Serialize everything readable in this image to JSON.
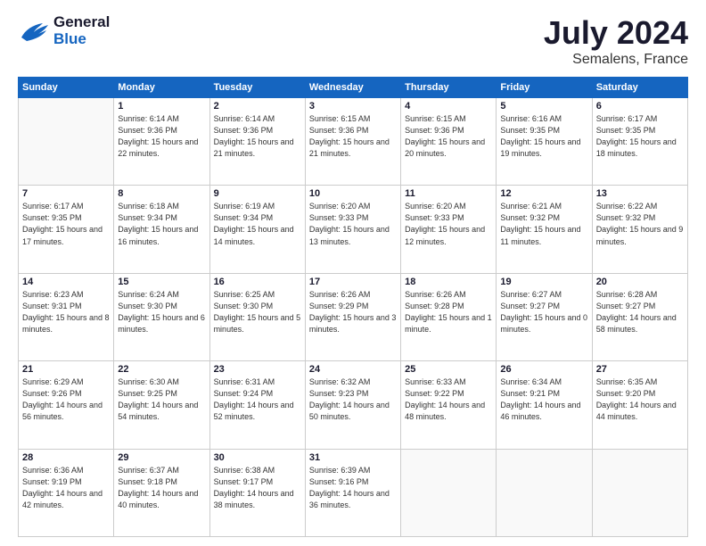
{
  "header": {
    "logo_general": "General",
    "logo_blue": "Blue",
    "month_year": "July 2024",
    "location": "Semalens, France"
  },
  "days_of_week": [
    "Sunday",
    "Monday",
    "Tuesday",
    "Wednesday",
    "Thursday",
    "Friday",
    "Saturday"
  ],
  "weeks": [
    [
      {
        "day": "",
        "empty": true
      },
      {
        "day": "1",
        "sunrise": "Sunrise: 6:14 AM",
        "sunset": "Sunset: 9:36 PM",
        "daylight": "Daylight: 15 hours and 22 minutes."
      },
      {
        "day": "2",
        "sunrise": "Sunrise: 6:14 AM",
        "sunset": "Sunset: 9:36 PM",
        "daylight": "Daylight: 15 hours and 21 minutes."
      },
      {
        "day": "3",
        "sunrise": "Sunrise: 6:15 AM",
        "sunset": "Sunset: 9:36 PM",
        "daylight": "Daylight: 15 hours and 21 minutes."
      },
      {
        "day": "4",
        "sunrise": "Sunrise: 6:15 AM",
        "sunset": "Sunset: 9:36 PM",
        "daylight": "Daylight: 15 hours and 20 minutes."
      },
      {
        "day": "5",
        "sunrise": "Sunrise: 6:16 AM",
        "sunset": "Sunset: 9:35 PM",
        "daylight": "Daylight: 15 hours and 19 minutes."
      },
      {
        "day": "6",
        "sunrise": "Sunrise: 6:17 AM",
        "sunset": "Sunset: 9:35 PM",
        "daylight": "Daylight: 15 hours and 18 minutes."
      }
    ],
    [
      {
        "day": "7",
        "sunrise": "Sunrise: 6:17 AM",
        "sunset": "Sunset: 9:35 PM",
        "daylight": "Daylight: 15 hours and 17 minutes."
      },
      {
        "day": "8",
        "sunrise": "Sunrise: 6:18 AM",
        "sunset": "Sunset: 9:34 PM",
        "daylight": "Daylight: 15 hours and 16 minutes."
      },
      {
        "day": "9",
        "sunrise": "Sunrise: 6:19 AM",
        "sunset": "Sunset: 9:34 PM",
        "daylight": "Daylight: 15 hours and 14 minutes."
      },
      {
        "day": "10",
        "sunrise": "Sunrise: 6:20 AM",
        "sunset": "Sunset: 9:33 PM",
        "daylight": "Daylight: 15 hours and 13 minutes."
      },
      {
        "day": "11",
        "sunrise": "Sunrise: 6:20 AM",
        "sunset": "Sunset: 9:33 PM",
        "daylight": "Daylight: 15 hours and 12 minutes."
      },
      {
        "day": "12",
        "sunrise": "Sunrise: 6:21 AM",
        "sunset": "Sunset: 9:32 PM",
        "daylight": "Daylight: 15 hours and 11 minutes."
      },
      {
        "day": "13",
        "sunrise": "Sunrise: 6:22 AM",
        "sunset": "Sunset: 9:32 PM",
        "daylight": "Daylight: 15 hours and 9 minutes."
      }
    ],
    [
      {
        "day": "14",
        "sunrise": "Sunrise: 6:23 AM",
        "sunset": "Sunset: 9:31 PM",
        "daylight": "Daylight: 15 hours and 8 minutes."
      },
      {
        "day": "15",
        "sunrise": "Sunrise: 6:24 AM",
        "sunset": "Sunset: 9:30 PM",
        "daylight": "Daylight: 15 hours and 6 minutes."
      },
      {
        "day": "16",
        "sunrise": "Sunrise: 6:25 AM",
        "sunset": "Sunset: 9:30 PM",
        "daylight": "Daylight: 15 hours and 5 minutes."
      },
      {
        "day": "17",
        "sunrise": "Sunrise: 6:26 AM",
        "sunset": "Sunset: 9:29 PM",
        "daylight": "Daylight: 15 hours and 3 minutes."
      },
      {
        "day": "18",
        "sunrise": "Sunrise: 6:26 AM",
        "sunset": "Sunset: 9:28 PM",
        "daylight": "Daylight: 15 hours and 1 minute."
      },
      {
        "day": "19",
        "sunrise": "Sunrise: 6:27 AM",
        "sunset": "Sunset: 9:27 PM",
        "daylight": "Daylight: 15 hours and 0 minutes."
      },
      {
        "day": "20",
        "sunrise": "Sunrise: 6:28 AM",
        "sunset": "Sunset: 9:27 PM",
        "daylight": "Daylight: 14 hours and 58 minutes."
      }
    ],
    [
      {
        "day": "21",
        "sunrise": "Sunrise: 6:29 AM",
        "sunset": "Sunset: 9:26 PM",
        "daylight": "Daylight: 14 hours and 56 minutes."
      },
      {
        "day": "22",
        "sunrise": "Sunrise: 6:30 AM",
        "sunset": "Sunset: 9:25 PM",
        "daylight": "Daylight: 14 hours and 54 minutes."
      },
      {
        "day": "23",
        "sunrise": "Sunrise: 6:31 AM",
        "sunset": "Sunset: 9:24 PM",
        "daylight": "Daylight: 14 hours and 52 minutes."
      },
      {
        "day": "24",
        "sunrise": "Sunrise: 6:32 AM",
        "sunset": "Sunset: 9:23 PM",
        "daylight": "Daylight: 14 hours and 50 minutes."
      },
      {
        "day": "25",
        "sunrise": "Sunrise: 6:33 AM",
        "sunset": "Sunset: 9:22 PM",
        "daylight": "Daylight: 14 hours and 48 minutes."
      },
      {
        "day": "26",
        "sunrise": "Sunrise: 6:34 AM",
        "sunset": "Sunset: 9:21 PM",
        "daylight": "Daylight: 14 hours and 46 minutes."
      },
      {
        "day": "27",
        "sunrise": "Sunrise: 6:35 AM",
        "sunset": "Sunset: 9:20 PM",
        "daylight": "Daylight: 14 hours and 44 minutes."
      }
    ],
    [
      {
        "day": "28",
        "sunrise": "Sunrise: 6:36 AM",
        "sunset": "Sunset: 9:19 PM",
        "daylight": "Daylight: 14 hours and 42 minutes."
      },
      {
        "day": "29",
        "sunrise": "Sunrise: 6:37 AM",
        "sunset": "Sunset: 9:18 PM",
        "daylight": "Daylight: 14 hours and 40 minutes."
      },
      {
        "day": "30",
        "sunrise": "Sunrise: 6:38 AM",
        "sunset": "Sunset: 9:17 PM",
        "daylight": "Daylight: 14 hours and 38 minutes."
      },
      {
        "day": "31",
        "sunrise": "Sunrise: 6:39 AM",
        "sunset": "Sunset: 9:16 PM",
        "daylight": "Daylight: 14 hours and 36 minutes."
      },
      {
        "day": "",
        "empty": true
      },
      {
        "day": "",
        "empty": true
      },
      {
        "day": "",
        "empty": true
      }
    ]
  ]
}
